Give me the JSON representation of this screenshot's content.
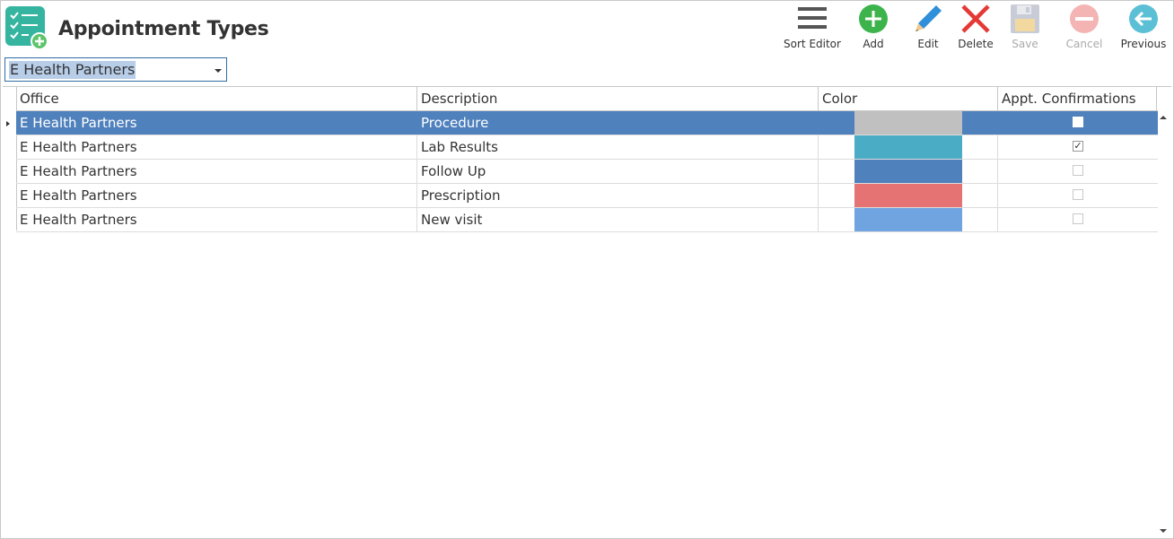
{
  "header": {
    "title": "Appointment Types"
  },
  "toolbar": {
    "sort_editor": "Sort Editor",
    "add": "Add",
    "edit": "Edit",
    "delete": "Delete",
    "save": "Save",
    "cancel": "Cancel",
    "previous": "Previous"
  },
  "office_select": {
    "value": "E Health Partners"
  },
  "grid": {
    "columns": [
      "Office",
      "Description",
      "Color",
      "Appt. Confirmations"
    ],
    "rows": [
      {
        "office": "E Health Partners",
        "description": "Procedure",
        "color": "#c0c0c0",
        "confirm": false,
        "selected": true
      },
      {
        "office": "E Health Partners",
        "description": "Lab Results",
        "color": "#4bacc6",
        "confirm": true,
        "selected": false
      },
      {
        "office": "E Health Partners",
        "description": "Follow Up",
        "color": "#4f81bd",
        "confirm": false,
        "selected": false
      },
      {
        "office": "E Health Partners",
        "description": "Prescription",
        "color": "#e57373",
        "confirm": false,
        "selected": false
      },
      {
        "office": "E Health Partners",
        "description": "New visit",
        "color": "#6fa4e0",
        "confirm": false,
        "selected": false
      }
    ]
  },
  "colors": {
    "selection": "#4f81bd",
    "add_green": "#3cb44b",
    "delete_red": "#e53935",
    "edit_blue": "#2f8fd8",
    "previous_teal": "#5bc0d6",
    "app_icon_teal": "#35b5a0"
  }
}
